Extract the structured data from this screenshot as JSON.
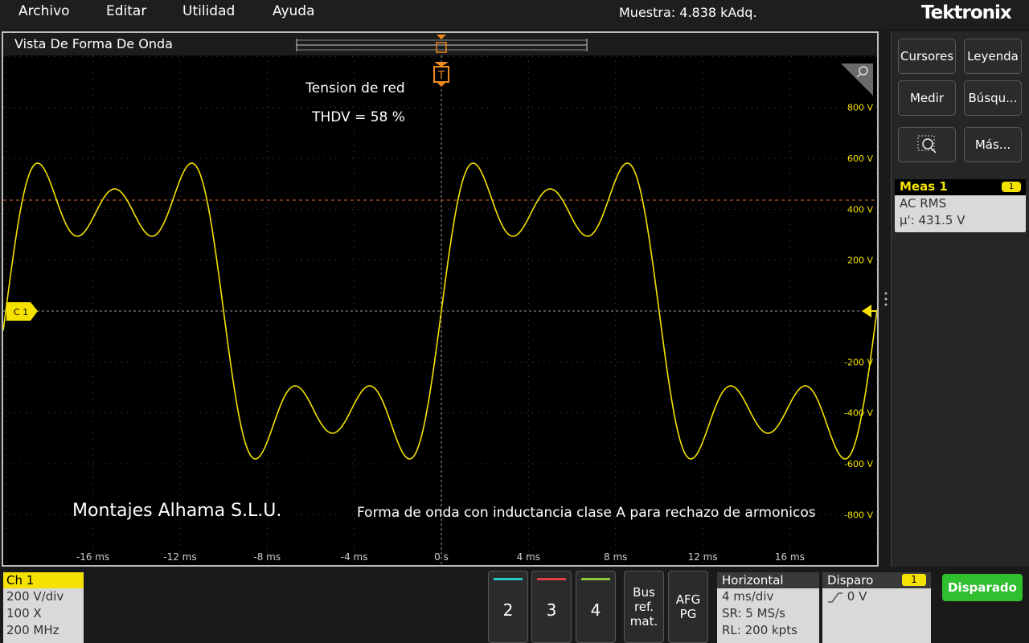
{
  "menu": [
    "Archivo",
    "Editar",
    "Utilidad",
    "Ayuda"
  ],
  "sample_status": "Muestra: 4.838 kAdq.",
  "brand": "Tektronix",
  "waveform_panel": {
    "title": "Vista De Forma De Onda",
    "annotation_title": "Tension de red",
    "annotation_thd": "THDV = 58 %",
    "company": "Montajes Alhama S.L.U.",
    "caption": "Forma de onda con inductancia clase A para rechazo de armonicos",
    "channel_marker": "C 1",
    "trigger_marker": "T",
    "trace_color": "#f5e200",
    "y_ticks": [
      "800 V",
      "600 V",
      "400 V",
      "200 V",
      "-200 V",
      "-400 V",
      "-600 V",
      "-800 V"
    ],
    "x_ticks": [
      "-16 ms",
      "-12 ms",
      "-8 ms",
      "-4 ms",
      "0 s",
      "4 ms",
      "8 ms",
      "12 ms",
      "16 ms"
    ]
  },
  "sidebar": {
    "buttons": [
      "Cursores",
      "Leyenda",
      "Medir",
      "Búsqu...",
      "Más..."
    ],
    "zoom_icon": "zoom-search-icon"
  },
  "measurement": {
    "title": "Meas 1",
    "badge": "1",
    "type": "AC RMS",
    "value": "μ': 431.5 V"
  },
  "channel1": {
    "label": "Ch 1",
    "scale": "200 V/div",
    "probe": "100 X",
    "bandwidth": "200 MHz"
  },
  "channel_buttons": [
    {
      "label": "2",
      "color": "#2ec4c4"
    },
    {
      "label": "3",
      "color": "#e0404a"
    },
    {
      "label": "4",
      "color": "#8cc63f"
    }
  ],
  "bus_button": [
    "Bus",
    "ref.",
    "mat."
  ],
  "afg_button": [
    "AFG",
    "PG"
  ],
  "horizontal": {
    "title": "Horizontal",
    "scale": "4 ms/div",
    "sample_rate": "SR: 5 MS/s",
    "record_length": "RL: 200 kpts"
  },
  "trigger": {
    "title": "Disparo",
    "badge": "1",
    "level": "0 V"
  },
  "trigger_status": "Disparado",
  "chart_data": {
    "type": "line",
    "xlabel": "",
    "ylabel": "",
    "x_unit": "ms",
    "y_unit": "V",
    "xlim": [
      -20,
      20
    ],
    "ylim": [
      -1000,
      1000
    ],
    "grid": true,
    "series": [
      {
        "color": "#f5e200",
        "fundamental_hz": 50,
        "harmonics": [
          {
            "order": 1,
            "amplitude_v": 520
          },
          {
            "order": 3,
            "amplitude_v": 220
          },
          {
            "order": 5,
            "amplitude_v": 180
          }
        ]
      }
    ],
    "reference_lines": [
      {
        "axis": "y",
        "value": 431.5,
        "style": "dashed",
        "color": "#e07030"
      }
    ]
  }
}
